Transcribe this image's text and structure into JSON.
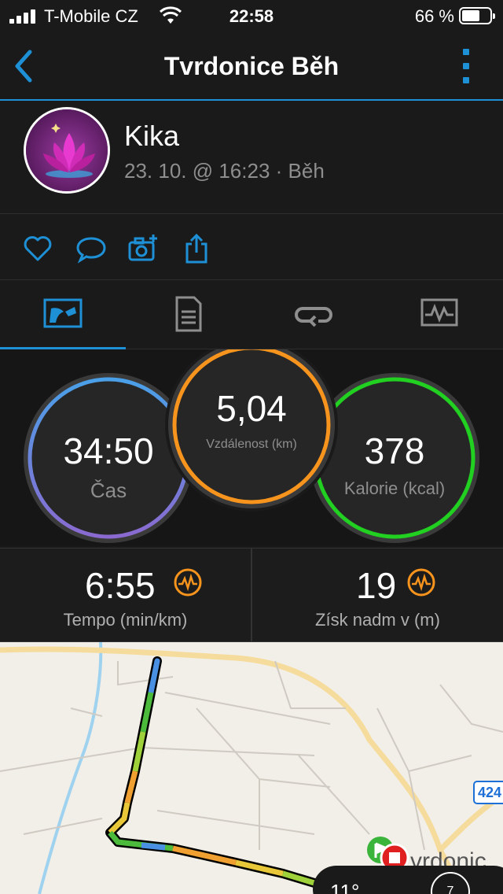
{
  "status": {
    "carrier": "T-Mobile CZ",
    "time": "22:58",
    "battery": "66 %",
    "battery_level": 0.66
  },
  "nav": {
    "title": "Tvrdonice Běh"
  },
  "profile": {
    "name": "Kika",
    "meta": "23. 10. @ 16:23 · Běh"
  },
  "actions": [
    "heart-icon",
    "comment-icon",
    "add-photo-icon",
    "share-icon"
  ],
  "tabs": [
    {
      "icon": "stats-tab-icon",
      "active": true
    },
    {
      "icon": "details-tab-icon",
      "active": false
    },
    {
      "icon": "laps-tab-icon",
      "active": false
    },
    {
      "icon": "charts-tab-icon",
      "active": false
    }
  ],
  "circles": {
    "time": {
      "value": "34:50",
      "label": "Čas",
      "color": "#4a90e2"
    },
    "distance": {
      "value": "5,04",
      "label": "Vzdálenost (km)",
      "color": "#f7941d"
    },
    "calories": {
      "value": "378",
      "label": "Kalorie (kcal)",
      "color": "#21d021"
    }
  },
  "stats": {
    "pace": {
      "value": "6:55",
      "label": "Tempo (min/km)"
    },
    "elevation": {
      "value": "19",
      "label": "Získ nadm v (m)"
    }
  },
  "map": {
    "road_number": "424",
    "town_fragment": "vrdonic",
    "weather_temp": "11°",
    "wind_value": "7"
  }
}
